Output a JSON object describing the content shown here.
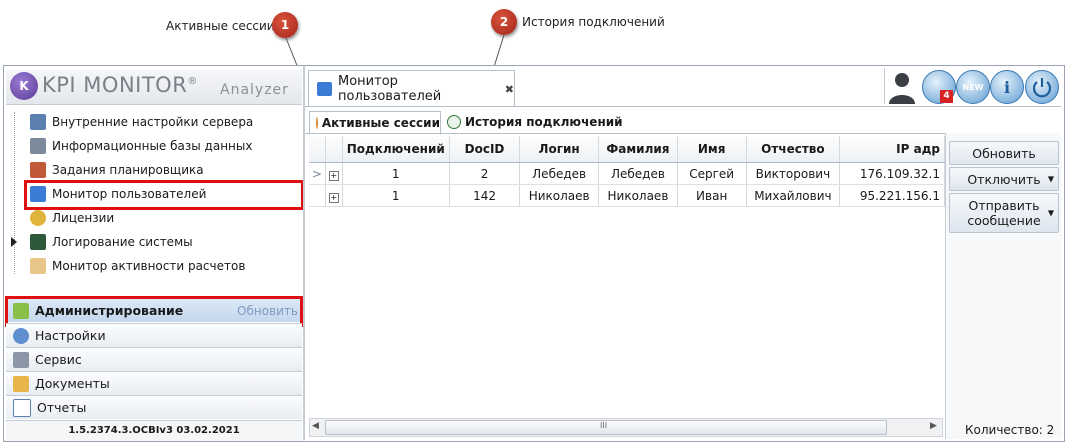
{
  "callouts": [
    {
      "num": "1",
      "label": "Активные сессии"
    },
    {
      "num": "2",
      "label": "История подключений"
    }
  ],
  "logo": {
    "title": "KPI MONITOR",
    "mark": "®",
    "subtitle": "Analyzer"
  },
  "nav_tree": [
    {
      "label": "Внутренние настройки сервера",
      "icon": "server-settings-icon"
    },
    {
      "label": "Информационные базы данных",
      "icon": "database-icon"
    },
    {
      "label": "Задания планировщика",
      "icon": "scheduler-icon"
    },
    {
      "label": "Монитор пользователей",
      "icon": "monitor-icon"
    },
    {
      "label": "Лицензии",
      "icon": "key-icon"
    },
    {
      "label": "Логирование системы",
      "icon": "log-icon"
    },
    {
      "label": "Монитор активности расчетов",
      "icon": "activity-icon"
    }
  ],
  "panels": {
    "admin": {
      "label": "Администрирование",
      "refresh": "Обновить"
    },
    "items": [
      {
        "label": "Настройки",
        "icon": "settings-icon"
      },
      {
        "label": "Сервис",
        "icon": "tools-icon"
      },
      {
        "label": "Документы",
        "icon": "documents-icon"
      },
      {
        "label": "Отчеты",
        "icon": "reports-icon"
      }
    ]
  },
  "version": "1.5.2374.3.OCBIv3  03.02.2021",
  "main_tab": {
    "label": "Монитор пользователей",
    "close": "✖"
  },
  "top_icons": {
    "notification_badge": "4",
    "new_badge": "NEW"
  },
  "subtabs": {
    "active": "Активные сессии",
    "history": "История подключений"
  },
  "grid": {
    "columns": [
      "Подключений",
      "DocID",
      "Логин",
      "Фамилия",
      "Имя",
      "Отчество",
      "IP адр"
    ],
    "rows": [
      [
        "1",
        "2",
        "Лебедев",
        "Лебедев",
        "Сергей",
        "Викторович",
        "176.109.32.1"
      ],
      [
        "1",
        "142",
        "Николаев",
        "Николаев",
        "Иван",
        "Михайлович",
        "95.221.156.1"
      ]
    ]
  },
  "actions": {
    "refresh": "Обновить",
    "disconnect": "Отключить",
    "send_message_line1": "Отправить",
    "send_message_line2": "сообщение",
    "count": "Количество: 2"
  },
  "scroll": {
    "thumb_glyph": "III"
  }
}
